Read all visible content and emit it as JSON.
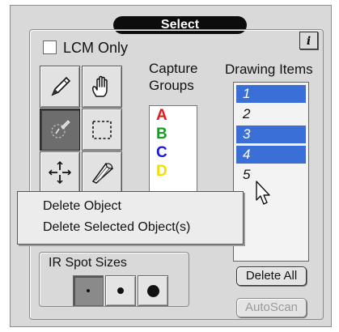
{
  "panel": {
    "title": "Select",
    "info_label": "i"
  },
  "lcm_only": {
    "label": "LCM Only",
    "checked": false
  },
  "tools": [
    {
      "name": "pen",
      "icon": "pen-icon",
      "active": false
    },
    {
      "name": "hand",
      "icon": "hand-icon",
      "active": false
    },
    {
      "name": "pointer",
      "icon": "pointer-target-icon",
      "active": true
    },
    {
      "name": "marquee",
      "icon": "dashed-rectangle-icon",
      "active": false
    },
    {
      "name": "spot",
      "icon": "crosshair-icon",
      "active": false
    },
    {
      "name": "laser",
      "icon": "laser-cone-icon",
      "active": false
    }
  ],
  "capture_groups": {
    "title": "Capture Groups",
    "items": [
      {
        "letter": "A",
        "color": "#e01b1b"
      },
      {
        "letter": "B",
        "color": "#1a9b24"
      },
      {
        "letter": "C",
        "color": "#1818d8"
      },
      {
        "letter": "D",
        "color": "#f0e000"
      }
    ]
  },
  "drawing_items": {
    "title": "Drawing Items",
    "items": [
      {
        "label": "1",
        "selected": true
      },
      {
        "label": "2",
        "selected": false
      },
      {
        "label": "3",
        "selected": true
      },
      {
        "label": "4",
        "selected": true
      },
      {
        "label": "5",
        "selected": false
      }
    ]
  },
  "context_menu": {
    "items": [
      "Delete Object",
      "Delete Selected Object(s)"
    ]
  },
  "buttons": {
    "delete_all": "Delete All",
    "autoscan": "AutoScan"
  },
  "ir_spot_sizes": {
    "label": "IR Spot Sizes",
    "options": [
      {
        "size": "small",
        "active": true
      },
      {
        "size": "medium",
        "active": false
      },
      {
        "size": "large",
        "active": false
      }
    ]
  },
  "colors": {
    "selection": "#3a6fd8",
    "panel": "#d9d9d9",
    "title_bar": "#0c0c0c",
    "disabled_text": "#9a9a9a"
  }
}
